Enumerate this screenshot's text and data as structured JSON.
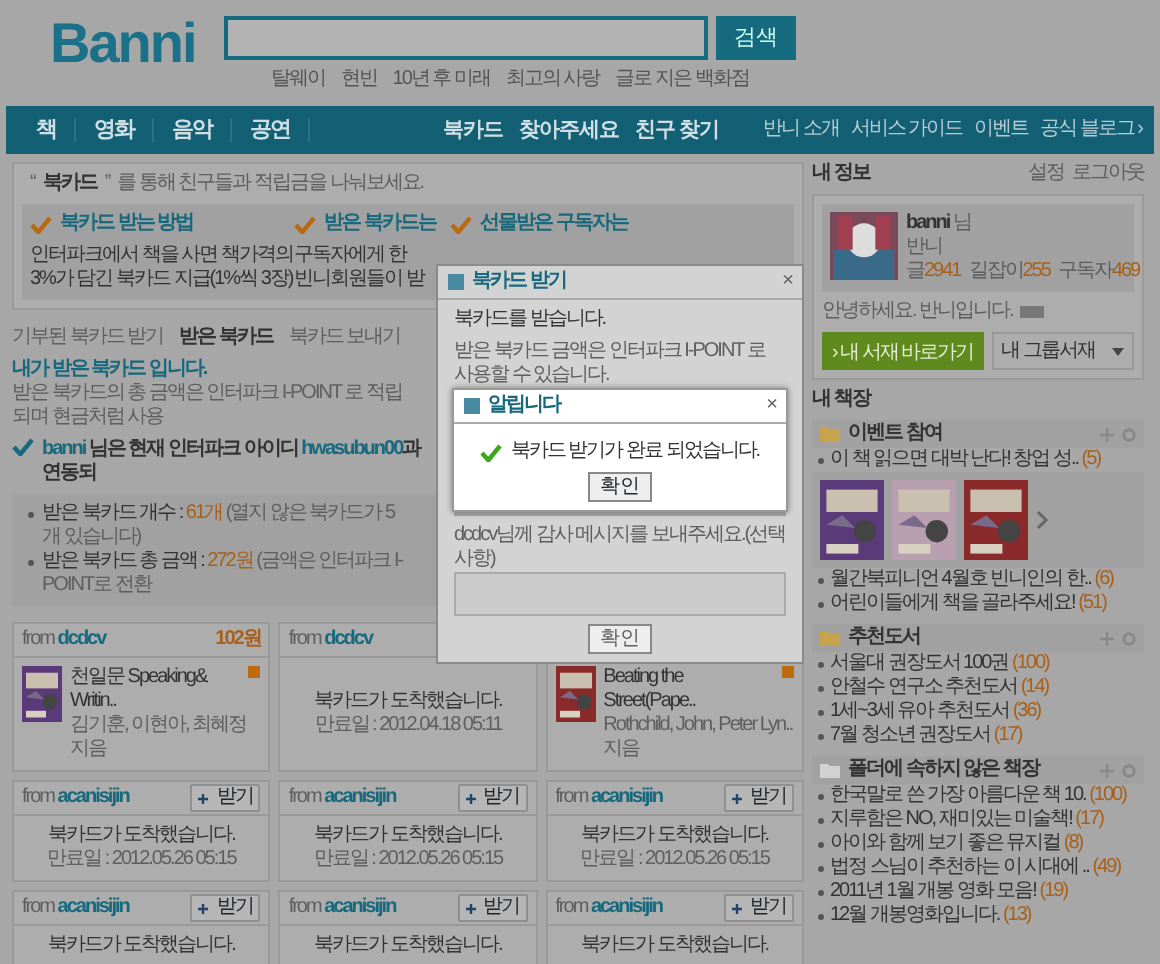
{
  "header": {
    "logo": "Banni",
    "search_button": "검색",
    "suggestions": [
      "탈웨이",
      "현빈",
      "10년 후 미래",
      "최고의 사랑",
      "글로 지은 백화점"
    ]
  },
  "nav": {
    "main": [
      "책",
      "영화",
      "음악",
      "공연"
    ],
    "center": [
      "북카드",
      "찾아주세요",
      "친구 찾기"
    ],
    "links": [
      "반니 소개",
      "서비스 가이드",
      "이벤트",
      "공식 블로그 ›"
    ]
  },
  "intro": {
    "open_quote": "“",
    "title": "북카드",
    "close_quote": "”",
    "text": "를 통해 친구들과 적립금을 나눠보세요."
  },
  "features": [
    {
      "title": "북카드 받는 방법",
      "lines": [
        "인터파크에서 책을 사면 책가격의",
        "3%가 담긴 북카드 지급(1%씩 3장)"
      ]
    },
    {
      "title": "받은 북카드는",
      "lines": [
        "구독자에게 한",
        "빈니회원들이 받"
      ]
    },
    {
      "title": "선물받은 구독자는"
    }
  ],
  "tabs": [
    {
      "label": "기부된 북카드 받기",
      "selected": false
    },
    {
      "label": "받은 북카드",
      "selected": true
    },
    {
      "label": "북카드 보내기",
      "selected": false
    }
  ],
  "received": {
    "heading": "내가 받은 북카드 입니다.",
    "description": "받은 북카드의 총 금액은 인터파크 I-POINT 로 적립되며 현금처럼 사용",
    "notice": [
      {
        "kind": "id",
        "text": "banni"
      },
      {
        "kind": "text",
        "text": " 님은 현재 인터파크 아이디 "
      },
      {
        "kind": "id",
        "text": "hwasubun00"
      },
      {
        "kind": "text",
        "text": "과 연동되"
      }
    ],
    "stats": [
      {
        "label": "받은 북카드 개수 :",
        "value": "61개",
        "note": "(열지 않은 북카드가 5개 있습니다)"
      },
      {
        "label": "받은 북카드 총 금액 :",
        "value": "272원",
        "note": "(금액은 인터파크 I-POINT로 전환"
      }
    ]
  },
  "cards": [
    {
      "kind": "book",
      "from": "from",
      "sender": "dcdcv",
      "amount": "102원",
      "title": "천일문 Speaking& Writin..",
      "author": "김기훈, 이현아, 최혜정 지음"
    },
    {
      "kind": "message",
      "from": "from",
      "sender": "dcdcv",
      "message": "북카드가 도착했습니다.",
      "expiry": "만료일 : 2012.04.18 05:11"
    },
    {
      "kind": "book",
      "title": "Beating the Street(Pape..",
      "author": "Rothchild, John, Peter Lyn.. 지음"
    },
    {
      "kind": "message",
      "from": "from",
      "sender": "acanisijin",
      "action": "받기",
      "message": "북카드가 도착했습니다.",
      "expiry": "만료일 : 2012.05.26 05:15"
    },
    {
      "kind": "message",
      "from": "from",
      "sender": "acanisijin",
      "action": "받기",
      "message": "북카드가 도착했습니다.",
      "expiry": "만료일 : 2012.05.26 05:15"
    },
    {
      "kind": "message",
      "from": "from",
      "sender": "acanisijin",
      "action": "받기",
      "message": "북카드가 도착했습니다.",
      "expiry": "만료일 : 2012.05.26 05:15"
    },
    {
      "kind": "message",
      "from": "from",
      "sender": "acanisijin",
      "action": "받기",
      "message": "북카드가 도착했습니다."
    },
    {
      "kind": "message",
      "from": "from",
      "sender": "acanisijin",
      "action": "받기",
      "message": "북카드가 도착했습니다."
    },
    {
      "kind": "message",
      "from": "from",
      "sender": "acanisijin",
      "action": "받기",
      "message": "북카드가 도착했습니다."
    }
  ],
  "my_info": {
    "title": "내 정보",
    "links": [
      "설정",
      "로그아웃"
    ],
    "user": "banni",
    "honorific": "님",
    "nickname": "반니",
    "counts": [
      {
        "label": "글",
        "value": "2941"
      },
      {
        "label": "길잡이",
        "value": "255"
      },
      {
        "label": "구독자",
        "value": "469"
      }
    ],
    "greeting": "안녕하세요. 반니입니다.",
    "library_button": "› 내 서재 바로가기",
    "group_select": "내 그룹서재"
  },
  "shelves": {
    "title": "내 책장",
    "folders": [
      {
        "name": "이벤트 참여",
        "color": "#c9a24c",
        "items": [
          {
            "title": "이 책 읽으면 대박 난다! 창업 성..",
            "count": "(5)"
          },
          {
            "title": "월간북피니언 4월호 빈니인의 한..",
            "count": "(6)"
          },
          {
            "title": "어린이들에게 책을 골라주세요!",
            "count": "(51)"
          }
        ]
      },
      {
        "name": "추천도서",
        "color": "#c9a24c",
        "items": [
          {
            "title": "서울대 권장도서 100권",
            "count": "(100)"
          },
          {
            "title": "안철수 연구소 추천도서",
            "count": "(14)"
          },
          {
            "title": "1세~3세 유아 추천도서",
            "count": "(36)"
          },
          {
            "title": "7월 청소년 권장도서",
            "count": "(17)"
          }
        ]
      },
      {
        "name": "폴더에 속하지 않은 책장",
        "color": "#d2d2d2",
        "items": [
          {
            "title": "한국말로 쓴 가장 아름다운 책 10.",
            "count": "(100)"
          },
          {
            "title": "지루함은 NO, 재미있는 미술책!",
            "count": "(17)"
          },
          {
            "title": "아이와 함께 보기 좋은 뮤지컬",
            "count": "(8)"
          },
          {
            "title": "법정 스님이 추천하는 이 시대에 ..",
            "count": "(49)"
          },
          {
            "title": "2011년 1월 개봉 영화 모음!",
            "count": "(19)"
          },
          {
            "title": "12월 개봉영화입니다.",
            "count": "(13)"
          }
        ]
      }
    ]
  },
  "dialog_receive": {
    "title": "북카드 받기",
    "close": "×",
    "message": "북카드를 받습니다.",
    "notes": [
      "받은 북카드 금액은 인터파크 I-POINT 로 사용할 수 있습니다."
    ],
    "prompt": "dcdcv님께 감사 메시지를 보내주세요.",
    "prompt_note": "(선택사항)",
    "button": "확인"
  },
  "dialog_notice": {
    "title": "알립니다",
    "close": "×",
    "message": "북카드 받기가 완료 되었습니다.",
    "button": "확인"
  }
}
